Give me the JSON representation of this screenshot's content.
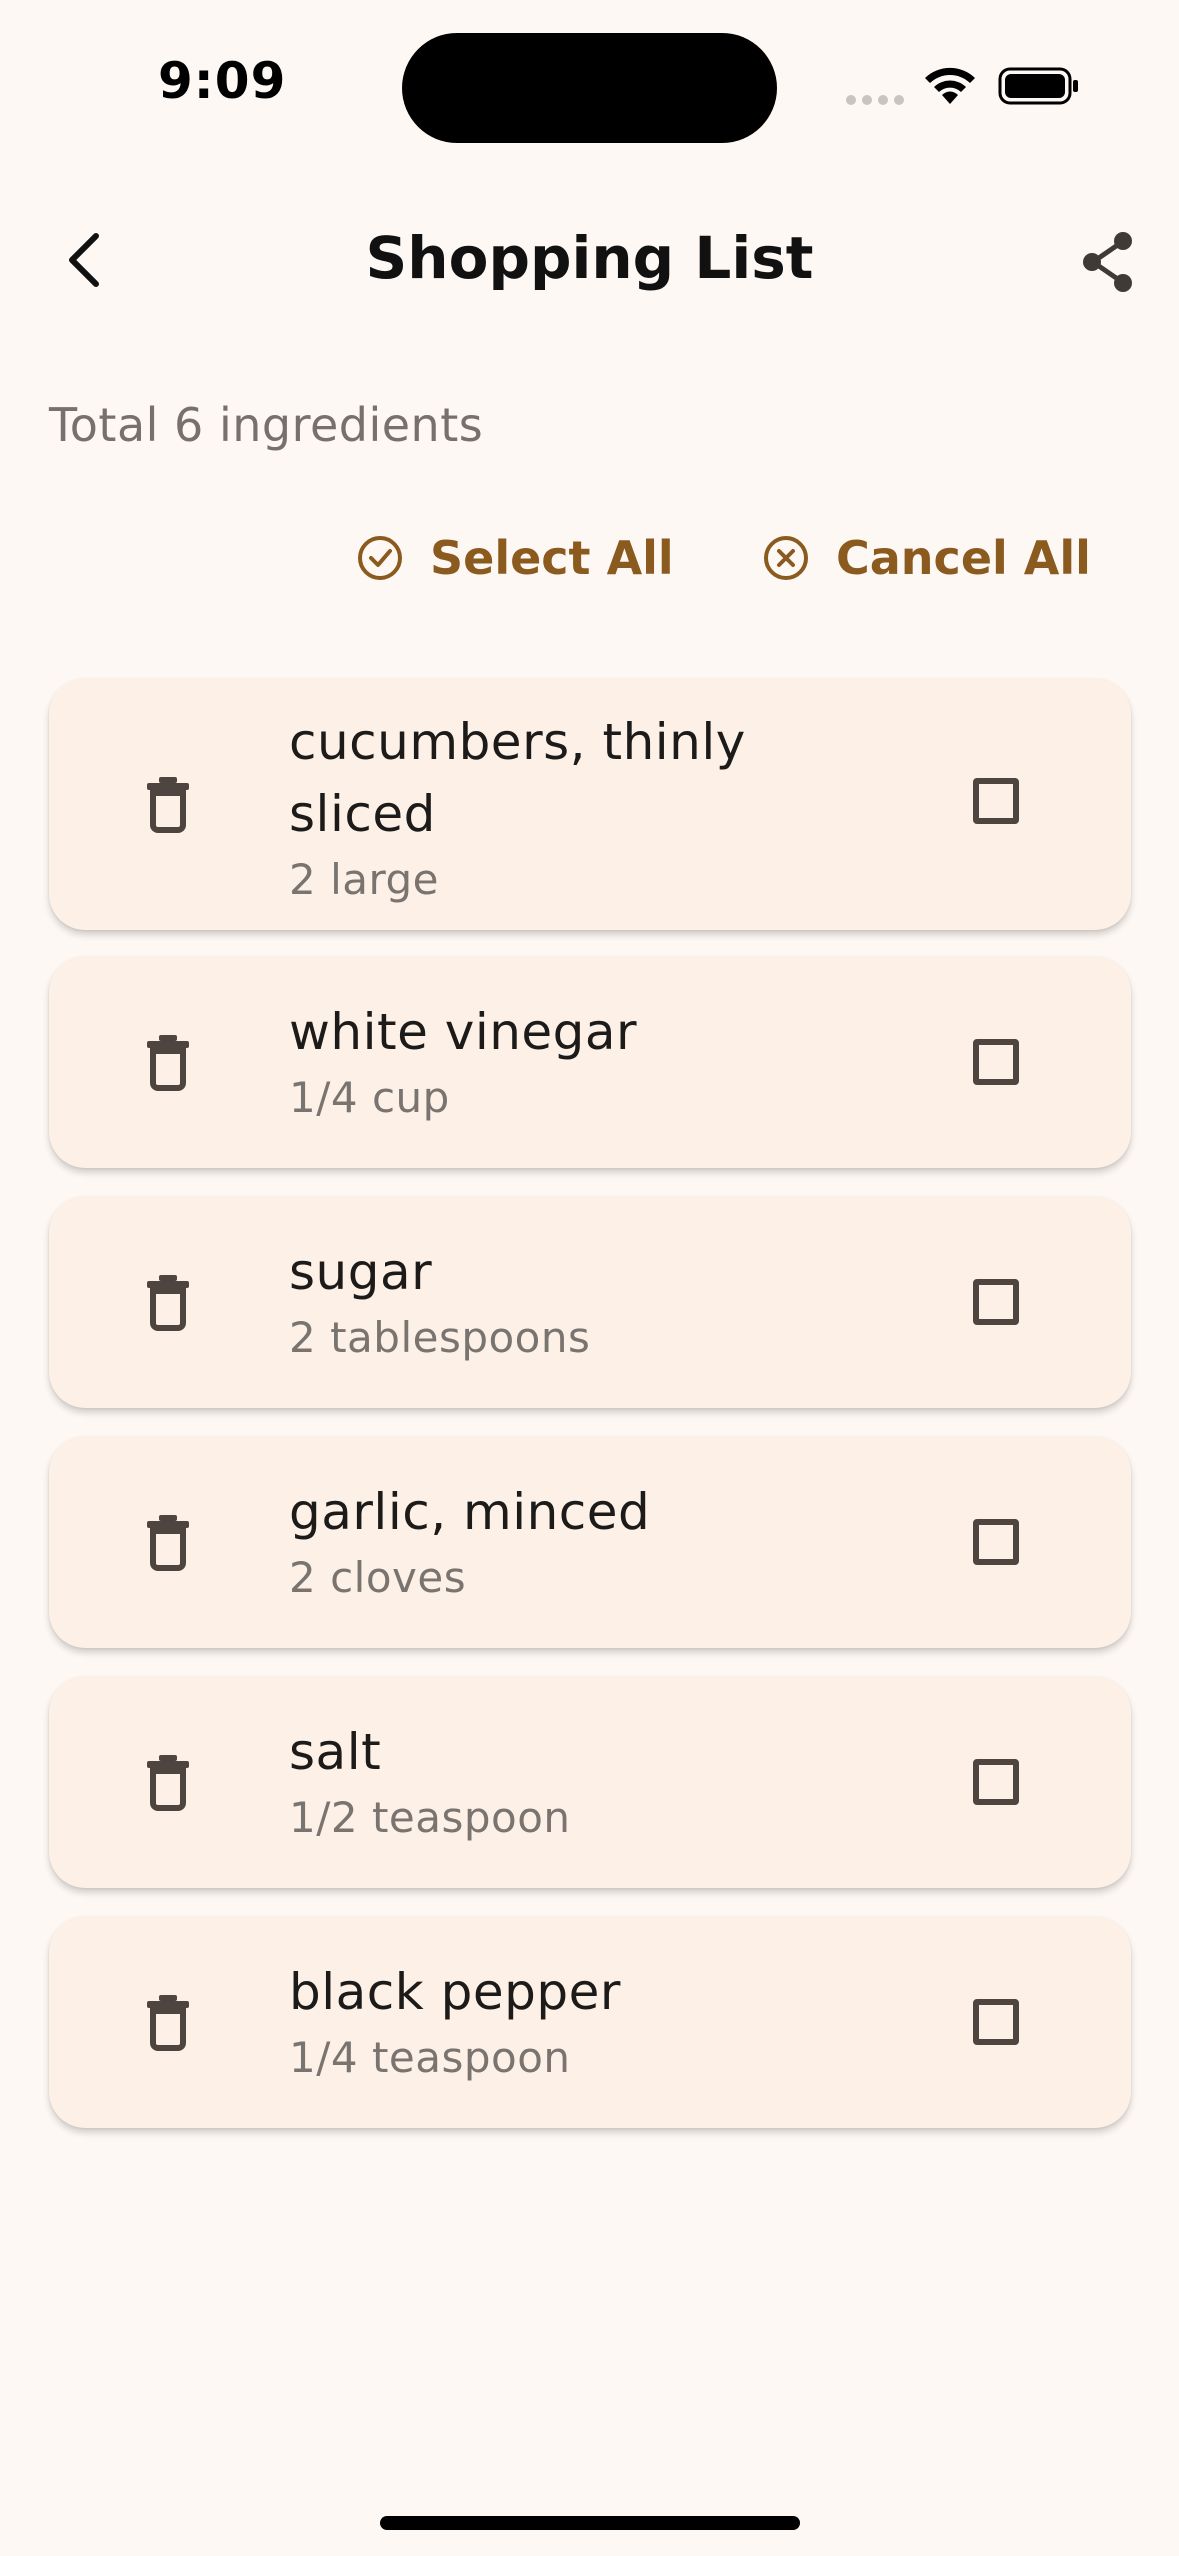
{
  "status_bar": {
    "time": "9:09"
  },
  "header": {
    "title": "Shopping List"
  },
  "summary": {
    "total_label": "Total 6 ingredients"
  },
  "actions": {
    "select_all": "Select All",
    "cancel_all": "Cancel All"
  },
  "items": [
    {
      "name": "cucumbers, thinly sliced",
      "quantity": "2 large",
      "checked": false
    },
    {
      "name": "white vinegar",
      "quantity": "1/4 cup",
      "checked": false
    },
    {
      "name": "sugar",
      "quantity": "2 tablespoons",
      "checked": false
    },
    {
      "name": "garlic, minced",
      "quantity": "2 cloves",
      "checked": false
    },
    {
      "name": "salt",
      "quantity": "1/2 teaspoon",
      "checked": false
    },
    {
      "name": "black pepper",
      "quantity": "1/4 teaspoon",
      "checked": false
    }
  ],
  "colors": {
    "accent": "#8a5a1e",
    "card_background": "#fdf0e6",
    "page_background": "#fdf8f4"
  }
}
